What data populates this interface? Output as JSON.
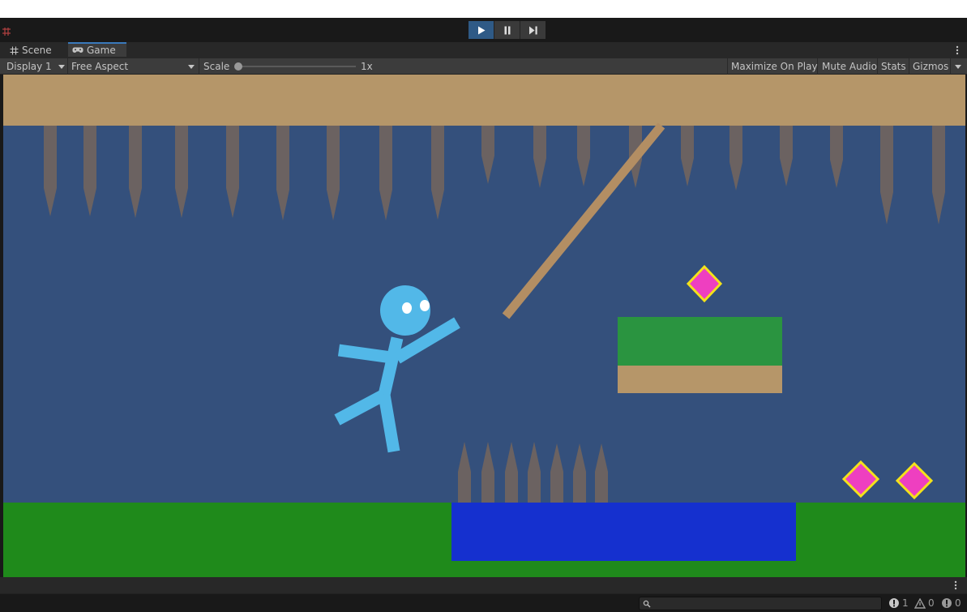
{
  "toolbar": {
    "buttons": [
      {
        "name": "play",
        "active": true
      },
      {
        "name": "pause",
        "active": false
      },
      {
        "name": "step",
        "active": false
      }
    ]
  },
  "tabs": {
    "scene": "Scene",
    "game": "Game"
  },
  "game_bar": {
    "display": "Display 1",
    "aspect": "Free Aspect",
    "scale_label": "Scale",
    "scale_value": "1x",
    "maximize": "Maximize On Play",
    "mute": "Mute Audio",
    "stats": "Stats",
    "gizmos": "Gizmos"
  },
  "status": {
    "info_count": "1",
    "warning_count": "0",
    "error_count": "0"
  },
  "colors": {
    "sky": "#34507c",
    "ceiling": "#b59669",
    "spike": "#6b6261",
    "grass": "#1f8a1b",
    "water": "#1530cf",
    "platform_grass": "#2a9440",
    "platform_dirt": "#b69669",
    "stickman": "#52b8e8",
    "gem_fill": "#ee3fc0",
    "gem_border": "#f4e21a",
    "rope": "#b38e63",
    "play_active": "#2f5a86"
  }
}
